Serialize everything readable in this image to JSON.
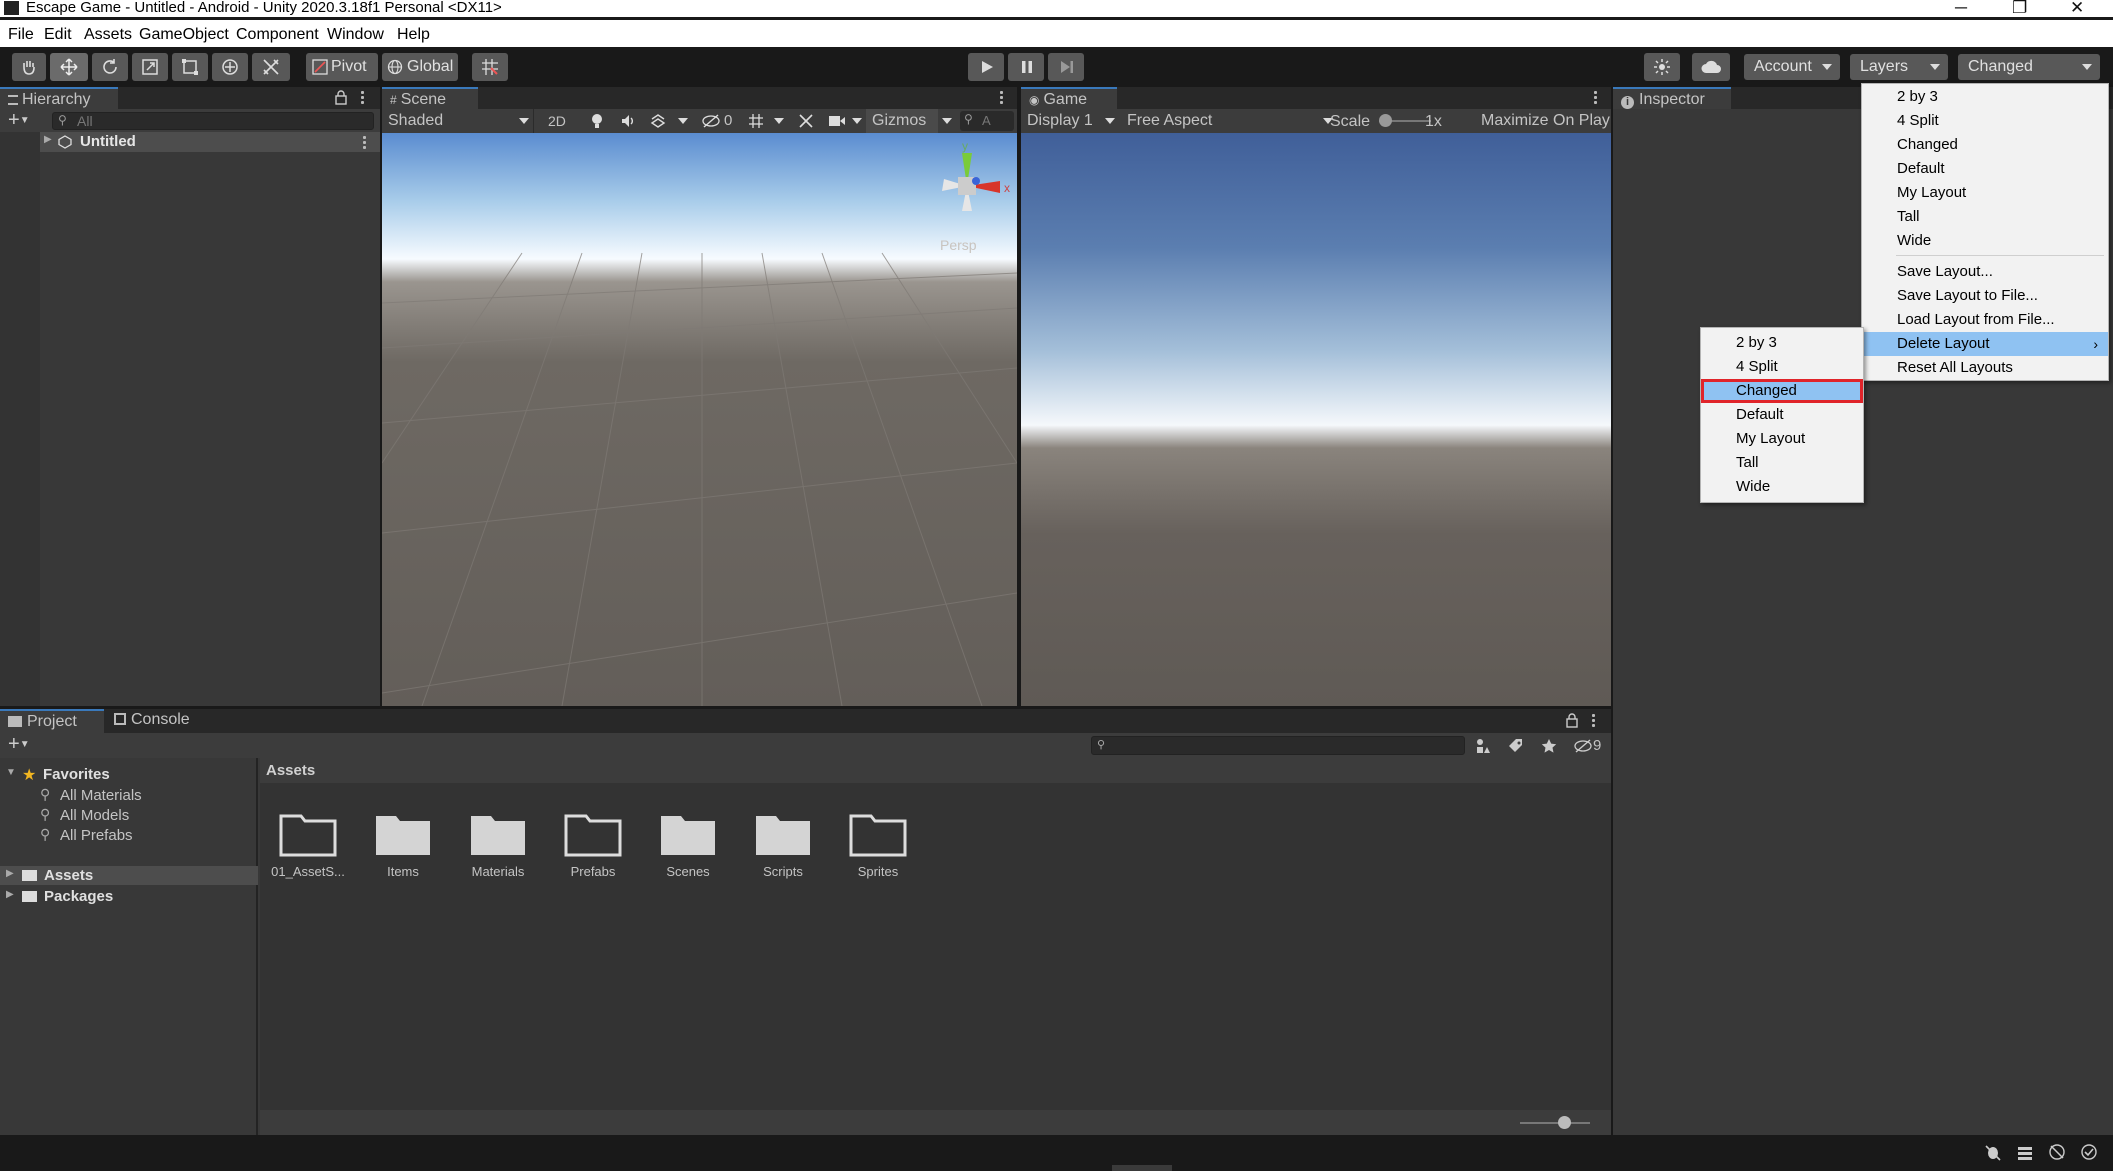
{
  "window": {
    "title": "Escape Game - Untitled - Android - Unity 2020.3.18f1 Personal <DX11>",
    "minimize": "─",
    "maximize": "❐",
    "close": "✕"
  },
  "menubar": [
    "File",
    "Edit",
    "Assets",
    "GameObject",
    "Component",
    "Window",
    "Help"
  ],
  "toolbar": {
    "pivot": "Pivot",
    "global": "Global",
    "account": "Account",
    "layers": "Layers",
    "layout": "Changed"
  },
  "hierarchy": {
    "tab": "Hierarchy",
    "search_placeholder": "All",
    "scene_item": "Untitled"
  },
  "scene": {
    "tab": "Scene",
    "shading": "Shaded",
    "mode_2d": "2D",
    "hidden_count": "0",
    "gizmos": "Gizmos",
    "search_placeholder": "A",
    "gizmo_y": "y",
    "gizmo_x": "x",
    "persp": "Persp"
  },
  "game": {
    "tab": "Game",
    "display": "Display 1",
    "aspect": "Free Aspect",
    "scale_label": "Scale",
    "scale_value": "1x",
    "maximize": "Maximize On Play"
  },
  "inspector": {
    "tab": "Inspector"
  },
  "project": {
    "tab": "Project",
    "console_tab": "Console",
    "hidden_count": "9",
    "favorites": "Favorites",
    "fav_items": [
      "All Materials",
      "All Models",
      "All Prefabs"
    ],
    "root_items": [
      "Assets",
      "Packages"
    ],
    "breadcrumb": "Assets",
    "assets": [
      "01_AssetS...",
      "Items",
      "Materials",
      "Prefabs",
      "Scenes",
      "Scripts",
      "Sprites"
    ]
  },
  "layout_menu": {
    "layouts": [
      "2 by 3",
      "4 Split",
      "Changed",
      "Default",
      "My Layout",
      "Tall",
      "Wide"
    ],
    "actions": [
      "Save Layout...",
      "Save Layout to File...",
      "Load Layout from File...",
      "Delete Layout",
      "Reset All Layouts"
    ]
  },
  "delete_submenu": {
    "items": [
      "2 by 3",
      "4 Split",
      "Changed",
      "Default",
      "My Layout",
      "Tall",
      "Wide"
    ],
    "highlighted": "Changed"
  },
  "colors": {
    "highlight": "#8fc2f2",
    "selection_outline": "#e0242a",
    "tab_accent": "#3a79bb"
  }
}
